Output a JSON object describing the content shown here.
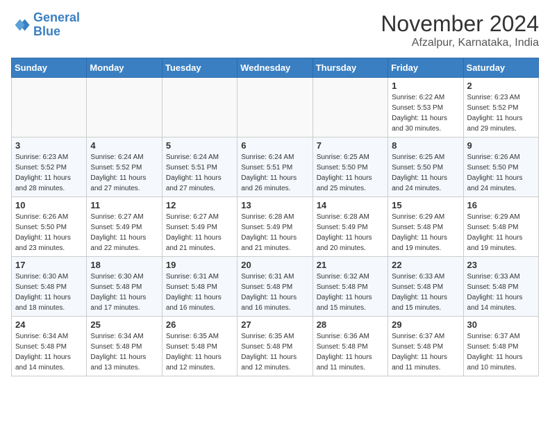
{
  "header": {
    "logo_general": "General",
    "logo_blue": "Blue",
    "month_title": "November 2024",
    "location": "Afzalpur, Karnataka, India"
  },
  "weekdays": [
    "Sunday",
    "Monday",
    "Tuesday",
    "Wednesday",
    "Thursday",
    "Friday",
    "Saturday"
  ],
  "weeks": [
    [
      {
        "day": "",
        "sunrise": "",
        "sunset": "",
        "daylight": ""
      },
      {
        "day": "",
        "sunrise": "",
        "sunset": "",
        "daylight": ""
      },
      {
        "day": "",
        "sunrise": "",
        "sunset": "",
        "daylight": ""
      },
      {
        "day": "",
        "sunrise": "",
        "sunset": "",
        "daylight": ""
      },
      {
        "day": "",
        "sunrise": "",
        "sunset": "",
        "daylight": ""
      },
      {
        "day": "1",
        "sunrise": "Sunrise: 6:22 AM",
        "sunset": "Sunset: 5:53 PM",
        "daylight": "Daylight: 11 hours and 30 minutes."
      },
      {
        "day": "2",
        "sunrise": "Sunrise: 6:23 AM",
        "sunset": "Sunset: 5:52 PM",
        "daylight": "Daylight: 11 hours and 29 minutes."
      }
    ],
    [
      {
        "day": "3",
        "sunrise": "Sunrise: 6:23 AM",
        "sunset": "Sunset: 5:52 PM",
        "daylight": "Daylight: 11 hours and 28 minutes."
      },
      {
        "day": "4",
        "sunrise": "Sunrise: 6:24 AM",
        "sunset": "Sunset: 5:52 PM",
        "daylight": "Daylight: 11 hours and 27 minutes."
      },
      {
        "day": "5",
        "sunrise": "Sunrise: 6:24 AM",
        "sunset": "Sunset: 5:51 PM",
        "daylight": "Daylight: 11 hours and 27 minutes."
      },
      {
        "day": "6",
        "sunrise": "Sunrise: 6:24 AM",
        "sunset": "Sunset: 5:51 PM",
        "daylight": "Daylight: 11 hours and 26 minutes."
      },
      {
        "day": "7",
        "sunrise": "Sunrise: 6:25 AM",
        "sunset": "Sunset: 5:50 PM",
        "daylight": "Daylight: 11 hours and 25 minutes."
      },
      {
        "day": "8",
        "sunrise": "Sunrise: 6:25 AM",
        "sunset": "Sunset: 5:50 PM",
        "daylight": "Daylight: 11 hours and 24 minutes."
      },
      {
        "day": "9",
        "sunrise": "Sunrise: 6:26 AM",
        "sunset": "Sunset: 5:50 PM",
        "daylight": "Daylight: 11 hours and 24 minutes."
      }
    ],
    [
      {
        "day": "10",
        "sunrise": "Sunrise: 6:26 AM",
        "sunset": "Sunset: 5:50 PM",
        "daylight": "Daylight: 11 hours and 23 minutes."
      },
      {
        "day": "11",
        "sunrise": "Sunrise: 6:27 AM",
        "sunset": "Sunset: 5:49 PM",
        "daylight": "Daylight: 11 hours and 22 minutes."
      },
      {
        "day": "12",
        "sunrise": "Sunrise: 6:27 AM",
        "sunset": "Sunset: 5:49 PM",
        "daylight": "Daylight: 11 hours and 21 minutes."
      },
      {
        "day": "13",
        "sunrise": "Sunrise: 6:28 AM",
        "sunset": "Sunset: 5:49 PM",
        "daylight": "Daylight: 11 hours and 21 minutes."
      },
      {
        "day": "14",
        "sunrise": "Sunrise: 6:28 AM",
        "sunset": "Sunset: 5:49 PM",
        "daylight": "Daylight: 11 hours and 20 minutes."
      },
      {
        "day": "15",
        "sunrise": "Sunrise: 6:29 AM",
        "sunset": "Sunset: 5:48 PM",
        "daylight": "Daylight: 11 hours and 19 minutes."
      },
      {
        "day": "16",
        "sunrise": "Sunrise: 6:29 AM",
        "sunset": "Sunset: 5:48 PM",
        "daylight": "Daylight: 11 hours and 19 minutes."
      }
    ],
    [
      {
        "day": "17",
        "sunrise": "Sunrise: 6:30 AM",
        "sunset": "Sunset: 5:48 PM",
        "daylight": "Daylight: 11 hours and 18 minutes."
      },
      {
        "day": "18",
        "sunrise": "Sunrise: 6:30 AM",
        "sunset": "Sunset: 5:48 PM",
        "daylight": "Daylight: 11 hours and 17 minutes."
      },
      {
        "day": "19",
        "sunrise": "Sunrise: 6:31 AM",
        "sunset": "Sunset: 5:48 PM",
        "daylight": "Daylight: 11 hours and 16 minutes."
      },
      {
        "day": "20",
        "sunrise": "Sunrise: 6:31 AM",
        "sunset": "Sunset: 5:48 PM",
        "daylight": "Daylight: 11 hours and 16 minutes."
      },
      {
        "day": "21",
        "sunrise": "Sunrise: 6:32 AM",
        "sunset": "Sunset: 5:48 PM",
        "daylight": "Daylight: 11 hours and 15 minutes."
      },
      {
        "day": "22",
        "sunrise": "Sunrise: 6:33 AM",
        "sunset": "Sunset: 5:48 PM",
        "daylight": "Daylight: 11 hours and 15 minutes."
      },
      {
        "day": "23",
        "sunrise": "Sunrise: 6:33 AM",
        "sunset": "Sunset: 5:48 PM",
        "daylight": "Daylight: 11 hours and 14 minutes."
      }
    ],
    [
      {
        "day": "24",
        "sunrise": "Sunrise: 6:34 AM",
        "sunset": "Sunset: 5:48 PM",
        "daylight": "Daylight: 11 hours and 14 minutes."
      },
      {
        "day": "25",
        "sunrise": "Sunrise: 6:34 AM",
        "sunset": "Sunset: 5:48 PM",
        "daylight": "Daylight: 11 hours and 13 minutes."
      },
      {
        "day": "26",
        "sunrise": "Sunrise: 6:35 AM",
        "sunset": "Sunset: 5:48 PM",
        "daylight": "Daylight: 11 hours and 12 minutes."
      },
      {
        "day": "27",
        "sunrise": "Sunrise: 6:35 AM",
        "sunset": "Sunset: 5:48 PM",
        "daylight": "Daylight: 11 hours and 12 minutes."
      },
      {
        "day": "28",
        "sunrise": "Sunrise: 6:36 AM",
        "sunset": "Sunset: 5:48 PM",
        "daylight": "Daylight: 11 hours and 11 minutes."
      },
      {
        "day": "29",
        "sunrise": "Sunrise: 6:37 AM",
        "sunset": "Sunset: 5:48 PM",
        "daylight": "Daylight: 11 hours and 11 minutes."
      },
      {
        "day": "30",
        "sunrise": "Sunrise: 6:37 AM",
        "sunset": "Sunset: 5:48 PM",
        "daylight": "Daylight: 11 hours and 10 minutes."
      }
    ]
  ]
}
